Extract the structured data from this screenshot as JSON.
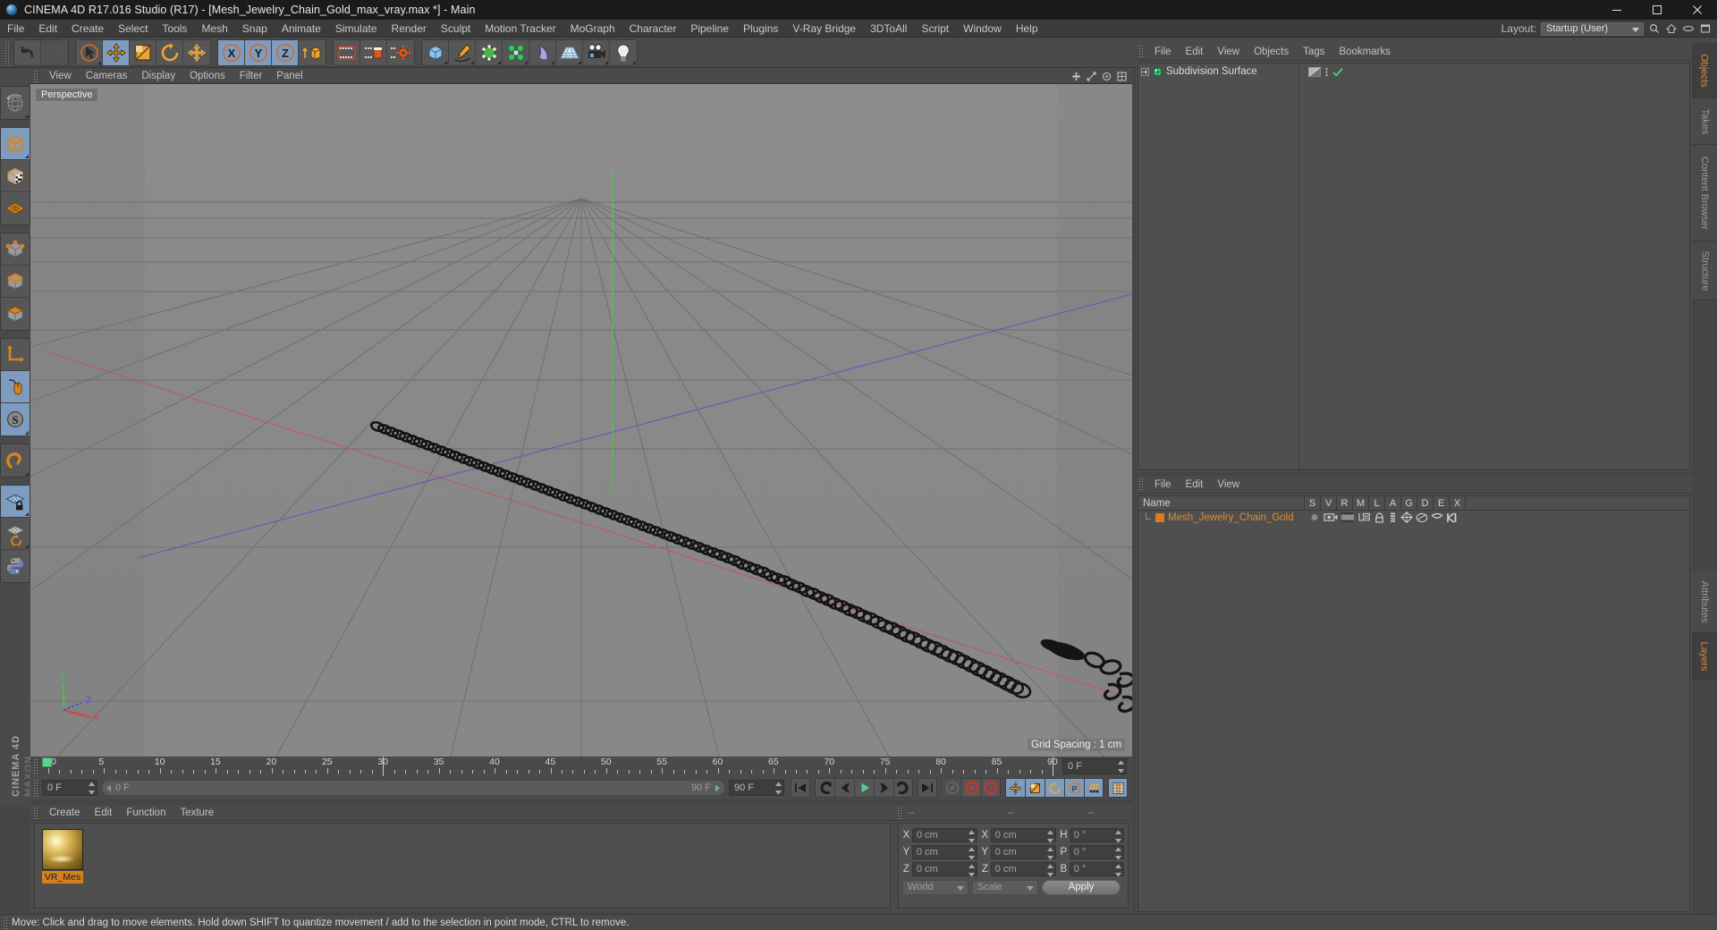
{
  "window": {
    "title": "CINEMA 4D R17.016 Studio (R17) - [Mesh_Jewelry_Chain_Gold_max_vray.max *] - Main",
    "logo_icon": "c4d-logo-icon",
    "minimize_icon": "minimize-icon",
    "maximize_icon": "maximize-icon",
    "close_icon": "close-icon"
  },
  "menubar": {
    "items": [
      "File",
      "Edit",
      "Create",
      "Select",
      "Tools",
      "Mesh",
      "Snap",
      "Animate",
      "Simulate",
      "Render",
      "Sculpt",
      "Motion Tracker",
      "MoGraph",
      "Character",
      "Pipeline",
      "Plugins",
      "V-Ray Bridge",
      "3DToAll",
      "Script",
      "Window",
      "Help"
    ],
    "layout_label": "Layout:",
    "layout_value": "Startup (User)",
    "search_icon": "search-icon",
    "home_icon": "home-icon",
    "eye_icon": "eye-icon",
    "window_icon": "window-icon"
  },
  "toolbar": {
    "groups": [
      {
        "buttons": [
          {
            "icon": "undo-icon",
            "label": "Undo",
            "state": "normal"
          },
          {
            "icon": "redo-icon",
            "label": "Redo",
            "state": "disabled"
          }
        ]
      },
      {
        "buttons": [
          {
            "icon": "select-cursor-icon",
            "label": "Live Selection",
            "state": "normal"
          },
          {
            "icon": "move-icon",
            "label": "Move",
            "state": "active"
          },
          {
            "icon": "scale-icon",
            "label": "Scale",
            "state": "normal"
          },
          {
            "icon": "rotate-icon",
            "label": "Rotate",
            "state": "normal"
          },
          {
            "icon": "move-axis-icon",
            "label": "Move Axis",
            "state": "normal"
          }
        ]
      },
      {
        "buttons": [
          {
            "icon": "x-axis-icon",
            "label": "X Axis",
            "state": "active"
          },
          {
            "icon": "y-axis-icon",
            "label": "Y Axis",
            "state": "active"
          },
          {
            "icon": "z-axis-icon",
            "label": "Z Axis",
            "state": "active"
          },
          {
            "icon": "world-object-axis-icon",
            "label": "World / Object Coordinate",
            "state": "normal"
          }
        ]
      },
      {
        "buttons": [
          {
            "icon": "render-view-icon",
            "label": "Render View",
            "state": "normal"
          },
          {
            "icon": "render-picture-viewer-icon",
            "label": "Render to Picture Viewer",
            "state": "normal"
          },
          {
            "icon": "render-settings-icon",
            "label": "Edit Render Settings",
            "state": "normal"
          }
        ]
      },
      {
        "buttons": [
          {
            "icon": "cube-primitive-icon",
            "label": "Add Cube Object",
            "state": "normal"
          },
          {
            "icon": "spline-pen-icon",
            "label": "Add Spline Object",
            "state": "normal"
          },
          {
            "icon": "nurbs-icon",
            "label": "Add Generator Object",
            "state": "normal"
          },
          {
            "icon": "mograph-icon",
            "label": "Add MoGraph Object",
            "state": "normal"
          },
          {
            "icon": "deformer-bend-icon",
            "label": "Add Deformer Object",
            "state": "normal"
          },
          {
            "icon": "environment-floor-icon",
            "label": "Add Scene Object",
            "state": "normal"
          },
          {
            "icon": "camera-icon",
            "label": "Add Camera Object",
            "state": "normal"
          },
          {
            "icon": "light-icon",
            "label": "Add Light Object",
            "state": "normal"
          }
        ]
      }
    ]
  },
  "lefttools": {
    "groups": [
      {
        "buttons": [
          {
            "icon": "viewport-globe-icon",
            "label": "Undo / Viewport",
            "state": "normal"
          }
        ]
      },
      {
        "buttons": [
          {
            "icon": "object-mode-icon",
            "label": "Object Mode",
            "state": "active"
          },
          {
            "icon": "texture-mode-icon",
            "label": "Texture Mode",
            "state": "normal"
          },
          {
            "icon": "workplane-mode-icon",
            "label": "Workplane Mode",
            "state": "normal"
          }
        ]
      },
      {
        "buttons": [
          {
            "icon": "points-mode-icon",
            "label": "Points Mode",
            "state": "normal"
          },
          {
            "icon": "edges-mode-icon",
            "label": "Edges Mode",
            "state": "normal"
          },
          {
            "icon": "polygons-mode-icon",
            "label": "Polygons Mode",
            "state": "normal"
          }
        ]
      },
      {
        "buttons": [
          {
            "icon": "axis-modify-icon",
            "label": "Enable Axis Modification",
            "state": "normal"
          },
          {
            "icon": "viewport-solo-icon",
            "label": "Enable Viewport Solo",
            "state": "active"
          },
          {
            "icon": "soft-selection-icon",
            "label": "Soft Selection",
            "state": "active"
          }
        ]
      },
      {
        "buttons": [
          {
            "icon": "magnet-icon",
            "label": "Magnet Tool",
            "state": "normal"
          }
        ]
      },
      {
        "buttons": [
          {
            "icon": "workplane-lock-icon",
            "label": "Lock Workplane",
            "state": "active"
          },
          {
            "icon": "workplane-align-icon",
            "label": "Align Workplane to Selection",
            "state": "normal"
          },
          {
            "icon": "python-icon",
            "label": "Python Script",
            "state": "normal"
          }
        ]
      }
    ],
    "brand_line1": "CINEMA 4D",
    "brand_line2": "MAXON"
  },
  "viewport": {
    "menu": [
      "View",
      "Cameras",
      "Display",
      "Options",
      "Filter",
      "Panel"
    ],
    "label": "Perspective",
    "grid_spacing": "Grid Spacing : 1 cm",
    "axis_labels": {
      "x": "X",
      "y": "Y",
      "z": "Z"
    },
    "axis_colors": {
      "x": "#e04040",
      "y": "#3ec43e",
      "z": "#4050e0"
    },
    "background_color": "#8a8a8a",
    "grid_line_color": "#6b6b6b",
    "x_axis_line_color": "#c05a5a",
    "z_axis_line_color": "#5a5ac0",
    "object_color": "#1a1a1a",
    "corner_icons": [
      "move-gizmo-icon",
      "scale-gizmo-icon",
      "rotate-gizmo-icon",
      "camera-reset-icon"
    ]
  },
  "timeline": {
    "tick_labels": [
      "0",
      "5",
      "10",
      "15",
      "20",
      "25",
      "30",
      "35",
      "40",
      "45",
      "50",
      "55",
      "60",
      "65",
      "70",
      "75",
      "80",
      "85",
      "90"
    ],
    "range_start": 0,
    "range_end": 90,
    "current_frame": "0 F",
    "playhead_frame": 30,
    "right_field": "0 F"
  },
  "animbar": {
    "current_frame_field": "0 F",
    "range_left": "0 F",
    "range_right": "90 F",
    "preview_end_field": "90 F",
    "buttons": [
      {
        "icon": "go-to-start-icon",
        "label": "Go to Start",
        "state": "normal"
      },
      {
        "icon": "play-backwards-keyframe-icon",
        "label": "Go to Previous Key",
        "state": "normal"
      },
      {
        "icon": "step-back-icon",
        "label": "Go to Previous Frame",
        "state": "normal"
      },
      {
        "icon": "play-forward-icon",
        "label": "Play Forwards",
        "state": "normal"
      },
      {
        "icon": "step-forward-icon",
        "label": "Go to Next Frame",
        "state": "normal"
      },
      {
        "icon": "play-next-keyframe-icon",
        "label": "Go to Next Key",
        "state": "normal"
      },
      {
        "icon": "go-to-end-icon",
        "label": "Go to End",
        "state": "normal"
      },
      {
        "icon": "record-key-disabled-icon",
        "label": "Autokeying",
        "state": "disabled"
      },
      {
        "icon": "record-active-objects-icon",
        "label": "Record Active Objects",
        "state": "normal"
      },
      {
        "icon": "keyframe-selection-icon",
        "label": "Keyframe Selection",
        "state": "normal"
      },
      {
        "icon": "position-key-icon",
        "label": "Position",
        "state": "active"
      },
      {
        "icon": "scale-key-icon",
        "label": "Scale",
        "state": "active"
      },
      {
        "icon": "rotation-key-icon",
        "label": "Rotation",
        "state": "active"
      },
      {
        "icon": "parameter-key-icon",
        "label": "Parameter",
        "state": "active"
      },
      {
        "icon": "point-level-animation-icon",
        "label": "Point Level Animation",
        "state": "active"
      },
      {
        "icon": "timeline-icon",
        "label": "Timeline",
        "state": "active"
      }
    ]
  },
  "material_manager": {
    "menu": [
      "Create",
      "Edit",
      "Function",
      "Texture"
    ],
    "materials": [
      {
        "name": "VR_Mes",
        "preview": "gold-sphere-preview",
        "selected": true
      }
    ]
  },
  "coordinate_manager": {
    "header": [
      "--",
      "--",
      "--"
    ],
    "rows": [
      {
        "pos_label": "X",
        "pos_value": "0 cm",
        "size_label": "X",
        "size_value": "0 cm",
        "rot_label": "H",
        "rot_value": "0 °"
      },
      {
        "pos_label": "Y",
        "pos_value": "0 cm",
        "size_label": "Y",
        "size_value": "0 cm",
        "rot_label": "P",
        "rot_value": "0 °"
      },
      {
        "pos_label": "Z",
        "pos_value": "0 cm",
        "size_label": "Z",
        "size_value": "0 cm",
        "rot_label": "B",
        "rot_value": "0 °"
      }
    ],
    "coord_system": "World",
    "transform_mode": "Scale",
    "apply_label": "Apply"
  },
  "object_manager": {
    "menu": [
      "File",
      "Edit",
      "View",
      "Objects",
      "Tags",
      "Bookmarks"
    ],
    "rows": [
      {
        "name": "Subdivision Surface",
        "icon": "subdivision-surface-icon",
        "expandable": true,
        "tags": [
          "visibility-dot-icon",
          "enabled-check-icon"
        ]
      }
    ]
  },
  "layer_manager": {
    "menu": [
      "File",
      "Edit",
      "View"
    ],
    "columns": [
      "Name",
      "S",
      "V",
      "R",
      "M",
      "L",
      "A",
      "G",
      "D",
      "E",
      "X"
    ],
    "rows": [
      {
        "name": "Mesh_Jewelry_Chain_Gold",
        "color": "#e07a1f",
        "icons": [
          "solo-dot-icon",
          "view-icon",
          "render-icon",
          "manager-icon",
          "lock-icon",
          "animation-icon",
          "generators-icon",
          "deformers-icon",
          "expression-icon",
          "xref-icon"
        ]
      }
    ]
  },
  "vertical_tabs": {
    "top": [
      {
        "label": "Objects",
        "active": true
      },
      {
        "label": "Takes",
        "active": false
      },
      {
        "label": "Content Browser",
        "active": false
      },
      {
        "label": "Structure",
        "active": false
      }
    ],
    "bottom": [
      {
        "label": "Attributes",
        "active": false
      },
      {
        "label": "Layers",
        "active": true
      }
    ]
  },
  "statusbar": {
    "grip_icon": "grip-icon",
    "text": "Move: Click and drag to move elements. Hold down SHIFT to quantize movement / add to the selection in point mode, CTRL to remove."
  },
  "colors": {
    "accent_orange": "#e08a2e",
    "active_blue": "#7e9cc0",
    "panel_bg": "#4a4a4a",
    "field_bg": "#3f3f3f",
    "titlebar_bg": "#1b1b1b"
  }
}
